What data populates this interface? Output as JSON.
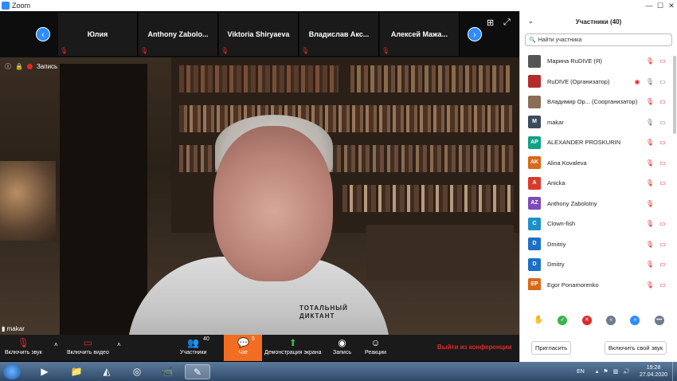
{
  "window": {
    "title": "Zoom",
    "controls": [
      "—",
      "☐",
      "✕"
    ]
  },
  "strip": {
    "tiles": [
      "Юлия",
      "Anthony  Zabolo...",
      "Viktoria Shiryaeva",
      "Владислав  Акс...",
      "Алексей  Мажа..."
    ]
  },
  "video": {
    "recording_label": "Запись",
    "speaker_name": "makar",
    "hoodie_text": "ТОТАЛЬНЫЙ ДИКТАНТ"
  },
  "toolbar": {
    "unmute": "Включить звук",
    "start_video": "Включить видео",
    "participants": "Участники",
    "participants_count": "40",
    "chat": "Чат",
    "chat_count": "5",
    "share": "Демонстрация экрана",
    "record": "Запись",
    "reactions": "Реакции",
    "end": "Выйти из конференции"
  },
  "panel": {
    "title": "Участники (40)",
    "search_placeholder": "Найти участника",
    "participants": [
      {
        "name": "Марина RuDIVE (Я)",
        "initials": "",
        "color": "#555555",
        "mic": "muted",
        "cam": "off"
      },
      {
        "name": "RuDIVE (Организатор)",
        "initials": "",
        "color": "#b32b2b",
        "mic": "on",
        "cam": "on"
      },
      {
        "name": "Владимир Ор... (Соорганизатор)",
        "initials": "",
        "color": "#8a6d55",
        "mic": "muted",
        "cam": "off"
      },
      {
        "name": "makar",
        "initials": "M",
        "color": "#3b4a5c",
        "mic": "on",
        "cam": "on"
      },
      {
        "name": "ALEXANDER PROSKURIN",
        "initials": "AP",
        "color": "#14a085",
        "mic": "muted",
        "cam": "off"
      },
      {
        "name": "Alina Kovaleva",
        "initials": "AK",
        "color": "#d9681a",
        "mic": "muted",
        "cam": "off"
      },
      {
        "name": "Anicka",
        "initials": "A",
        "color": "#d83b2b",
        "mic": "muted",
        "cam": "off"
      },
      {
        "name": "Anthony Zabolotny",
        "initials": "AZ",
        "color": "#7b4bb8",
        "mic": "muted",
        "cam": ""
      },
      {
        "name": "Clown-fish",
        "initials": "C",
        "color": "#1e90c8",
        "mic": "muted",
        "cam": "off"
      },
      {
        "name": "Dmitriy",
        "initials": "D",
        "color": "#1e6fc8",
        "mic": "muted",
        "cam": "off"
      },
      {
        "name": "Dmitry",
        "initials": "D",
        "color": "#1e6fc8",
        "mic": "muted",
        "cam": "off"
      },
      {
        "name": "Egor Ponamorenko",
        "initials": "EP",
        "color": "#d9681a",
        "mic": "muted",
        "cam": "off"
      }
    ],
    "invite": "Пригласить",
    "unmute_me": "Включить свой звук"
  },
  "taskbar": {
    "lang": "EN",
    "time": "19:28",
    "date": "27.04.2020"
  }
}
